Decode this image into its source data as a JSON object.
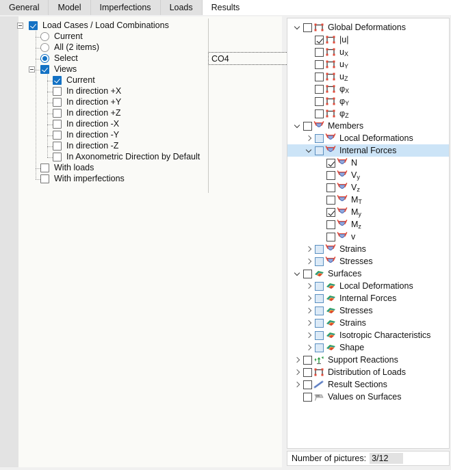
{
  "tabs": [
    {
      "label": "General",
      "active": false
    },
    {
      "label": "Model",
      "active": false
    },
    {
      "label": "Imperfections",
      "active": false
    },
    {
      "label": "Loads",
      "active": false
    },
    {
      "label": "Results",
      "active": true
    }
  ],
  "left_panel": {
    "value_field": {
      "value": "CO4"
    },
    "tree": [
      {
        "label": "Load Cases / Load Combinations",
        "control": "checkbox",
        "state": "checked",
        "indent": 0,
        "expander": "minus"
      },
      {
        "label": "Current",
        "control": "radio",
        "state": "unchecked",
        "indent": 1
      },
      {
        "label": "All (2 items)",
        "control": "radio",
        "state": "unchecked",
        "indent": 1
      },
      {
        "label": "Select",
        "control": "radio",
        "state": "checked",
        "indent": 1
      },
      {
        "label": "Views",
        "control": "checkbox",
        "state": "checked",
        "indent": 1,
        "expander": "minus"
      },
      {
        "label": "Current",
        "control": "checkbox",
        "state": "checked",
        "indent": 2
      },
      {
        "label": "In direction +X",
        "control": "checkbox",
        "state": "unchecked",
        "indent": 2
      },
      {
        "label": "In direction +Y",
        "control": "checkbox",
        "state": "unchecked",
        "indent": 2
      },
      {
        "label": "In direction +Z",
        "control": "checkbox",
        "state": "unchecked",
        "indent": 2
      },
      {
        "label": "In direction -X",
        "control": "checkbox",
        "state": "unchecked",
        "indent": 2
      },
      {
        "label": "In direction -Y",
        "control": "checkbox",
        "state": "unchecked",
        "indent": 2
      },
      {
        "label": "In direction -Z",
        "control": "checkbox",
        "state": "unchecked",
        "indent": 2
      },
      {
        "label": "In Axonometric Direction by Default",
        "control": "checkbox",
        "state": "unchecked",
        "indent": 2
      },
      {
        "label": "With loads",
        "control": "checkbox",
        "state": "unchecked",
        "indent": 1
      },
      {
        "label": "With imperfections",
        "control": "checkbox",
        "state": "unchecked",
        "indent": 1
      }
    ]
  },
  "right_panel": {
    "tree": [
      {
        "label": "Global Deformations",
        "icon": "frame-icon",
        "indent": 0,
        "chevron": "down",
        "checkbox": "unchecked",
        "selected": false
      },
      {
        "label": "|u|",
        "icon": "frame-icon",
        "indent": 1,
        "chevron": "none",
        "checkbox": "checked",
        "selected": false
      },
      {
        "label": "u",
        "sub": "X",
        "icon": "frame-icon",
        "indent": 1,
        "chevron": "none",
        "checkbox": "unchecked",
        "selected": false
      },
      {
        "label": "u",
        "sub": "Y",
        "icon": "frame-icon",
        "indent": 1,
        "chevron": "none",
        "checkbox": "unchecked",
        "selected": false
      },
      {
        "label": "u",
        "sub": "Z",
        "icon": "frame-icon",
        "indent": 1,
        "chevron": "none",
        "checkbox": "unchecked",
        "selected": false
      },
      {
        "label": "φ",
        "sub": "X",
        "icon": "frame-icon",
        "indent": 1,
        "chevron": "none",
        "checkbox": "unchecked",
        "selected": false
      },
      {
        "label": "φ",
        "sub": "Y",
        "icon": "frame-icon",
        "indent": 1,
        "chevron": "none",
        "checkbox": "unchecked",
        "selected": false
      },
      {
        "label": "φ",
        "sub": "Z",
        "icon": "frame-icon",
        "indent": 1,
        "chevron": "none",
        "checkbox": "unchecked",
        "selected": false
      },
      {
        "label": "Members",
        "icon": "member-icon",
        "indent": 0,
        "chevron": "down",
        "checkbox": "unchecked",
        "selected": false
      },
      {
        "label": "Local Deformations",
        "icon": "member-icon",
        "indent": 1,
        "chevron": "right",
        "checkbox": "tristate",
        "selected": false
      },
      {
        "label": "Internal Forces",
        "icon": "member-icon",
        "indent": 1,
        "chevron": "down",
        "checkbox": "tristate",
        "selected": true
      },
      {
        "label": "N",
        "icon": "member-icon",
        "indent": 2,
        "chevron": "none",
        "checkbox": "checked",
        "selected": false
      },
      {
        "label": "V",
        "sub": "y",
        "icon": "member-icon",
        "indent": 2,
        "chevron": "none",
        "checkbox": "unchecked",
        "selected": false
      },
      {
        "label": "V",
        "sub": "z",
        "icon": "member-icon",
        "indent": 2,
        "chevron": "none",
        "checkbox": "unchecked",
        "selected": false
      },
      {
        "label": "M",
        "sub": "T",
        "icon": "member-icon",
        "indent": 2,
        "chevron": "none",
        "checkbox": "unchecked",
        "selected": false
      },
      {
        "label": "M",
        "sub": "y",
        "icon": "member-icon",
        "indent": 2,
        "chevron": "none",
        "checkbox": "checked",
        "selected": false
      },
      {
        "label": "M",
        "sub": "z",
        "icon": "member-icon",
        "indent": 2,
        "chevron": "none",
        "checkbox": "unchecked",
        "selected": false
      },
      {
        "label": "v",
        "icon": "member-icon",
        "indent": 2,
        "chevron": "none",
        "checkbox": "unchecked",
        "selected": false
      },
      {
        "label": "Strains",
        "icon": "member-icon",
        "indent": 1,
        "chevron": "right",
        "checkbox": "tristate",
        "selected": false
      },
      {
        "label": "Stresses",
        "icon": "member-icon",
        "indent": 1,
        "chevron": "right",
        "checkbox": "tristate",
        "selected": false
      },
      {
        "label": "Surfaces",
        "icon": "surface-icon",
        "indent": 0,
        "chevron": "down",
        "checkbox": "unchecked",
        "selected": false
      },
      {
        "label": "Local Deformations",
        "icon": "surface-icon",
        "indent": 1,
        "chevron": "right",
        "checkbox": "tristate",
        "selected": false
      },
      {
        "label": "Internal Forces",
        "icon": "surface-icon",
        "indent": 1,
        "chevron": "right",
        "checkbox": "tristate",
        "selected": false
      },
      {
        "label": "Stresses",
        "icon": "surface-icon",
        "indent": 1,
        "chevron": "right",
        "checkbox": "tristate",
        "selected": false
      },
      {
        "label": "Strains",
        "icon": "surface-icon",
        "indent": 1,
        "chevron": "right",
        "checkbox": "tristate",
        "selected": false
      },
      {
        "label": "Isotropic Characteristics",
        "icon": "surface-icon",
        "indent": 1,
        "chevron": "right",
        "checkbox": "tristate",
        "selected": false
      },
      {
        "label": "Shape",
        "icon": "surface-icon",
        "indent": 1,
        "chevron": "right",
        "checkbox": "tristate",
        "selected": false
      },
      {
        "label": "Support Reactions",
        "icon": "support-reactions-icon",
        "indent": 0,
        "chevron": "right",
        "checkbox": "unchecked",
        "selected": false
      },
      {
        "label": "Distribution of Loads",
        "icon": "frame-icon",
        "indent": 0,
        "chevron": "right",
        "checkbox": "unchecked",
        "selected": false
      },
      {
        "label": "Result Sections",
        "icon": "result-section-icon",
        "indent": 0,
        "chevron": "right",
        "checkbox": "unchecked",
        "selected": false
      },
      {
        "label": "Values on Surfaces",
        "icon": "values-on-surfaces-icon",
        "indent": 0,
        "chevron": "none",
        "checkbox": "unchecked",
        "selected": false
      }
    ]
  },
  "status_bar": {
    "label": "Number of pictures:",
    "value": "3/12"
  },
  "colors": {
    "accent_blue": "#1472c4",
    "selection_blue": "#cce4f7",
    "panel_bg": "#f0f0f0",
    "tree_bg": "#fafaf7"
  }
}
